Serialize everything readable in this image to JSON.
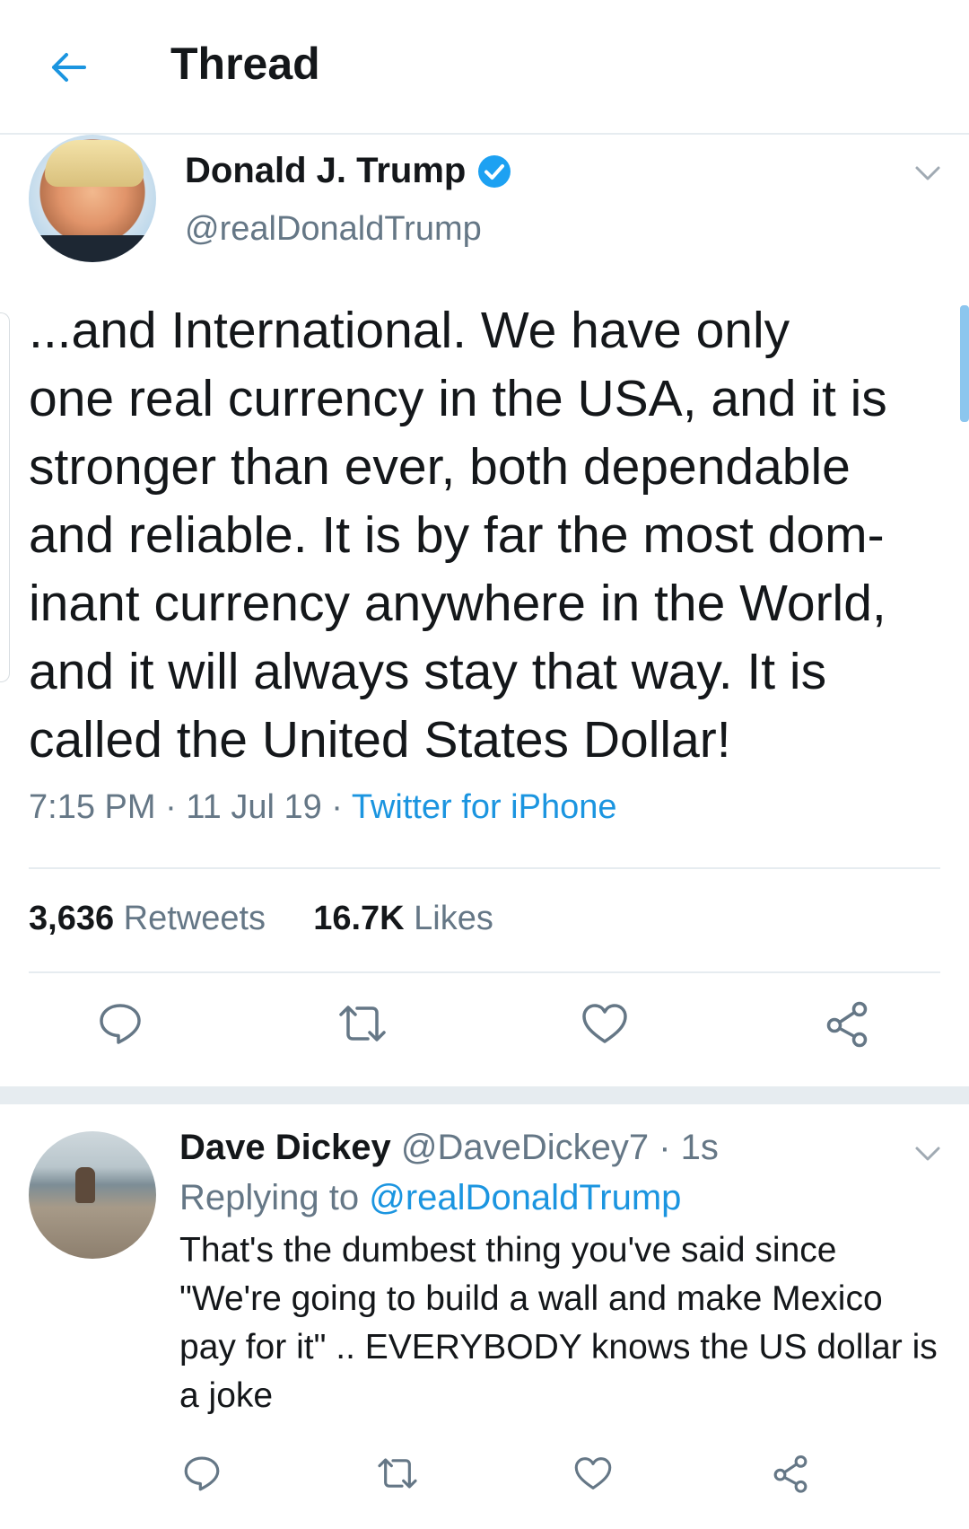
{
  "header": {
    "title": "Thread"
  },
  "main_tweet": {
    "name": "Donald J. Trump",
    "handle": "@realDonaldTrump",
    "verified": true,
    "text": "...and International. We have only\none real currency in the USA, and it is\nstronger than ever, both dependable\nand reliable. It is by far the most dom-\ninant currency anywhere in the World,\nand it will always stay that way. It is\ncalled the United States Dollar!",
    "time": "7:15 PM",
    "date": "11 Jul 19",
    "source": "Twitter for iPhone",
    "retweets_count": "3,636",
    "retweets_label": "Retweets",
    "likes_count": "16.7K",
    "likes_label": "Likes"
  },
  "reply": {
    "name": "Dave Dickey",
    "handle": "@DaveDickey7",
    "age": "1s",
    "replying_to_label": "Replying to",
    "replying_to_handle": "@realDonaldTrump",
    "text": "That's the dumbest thing you've said since \"We're going to build a wall and make Mexico pay for it\" .. EVERYBODY knows the US dollar is a joke"
  },
  "colors": {
    "accent": "#1b95e0",
    "muted": "#657786",
    "text": "#14171a",
    "divider": "#e6ecf0"
  },
  "icons": [
    "back-arrow-icon",
    "verified-badge-icon",
    "chevron-down-icon",
    "reply-icon",
    "retweet-icon",
    "like-icon",
    "share-icon"
  ]
}
